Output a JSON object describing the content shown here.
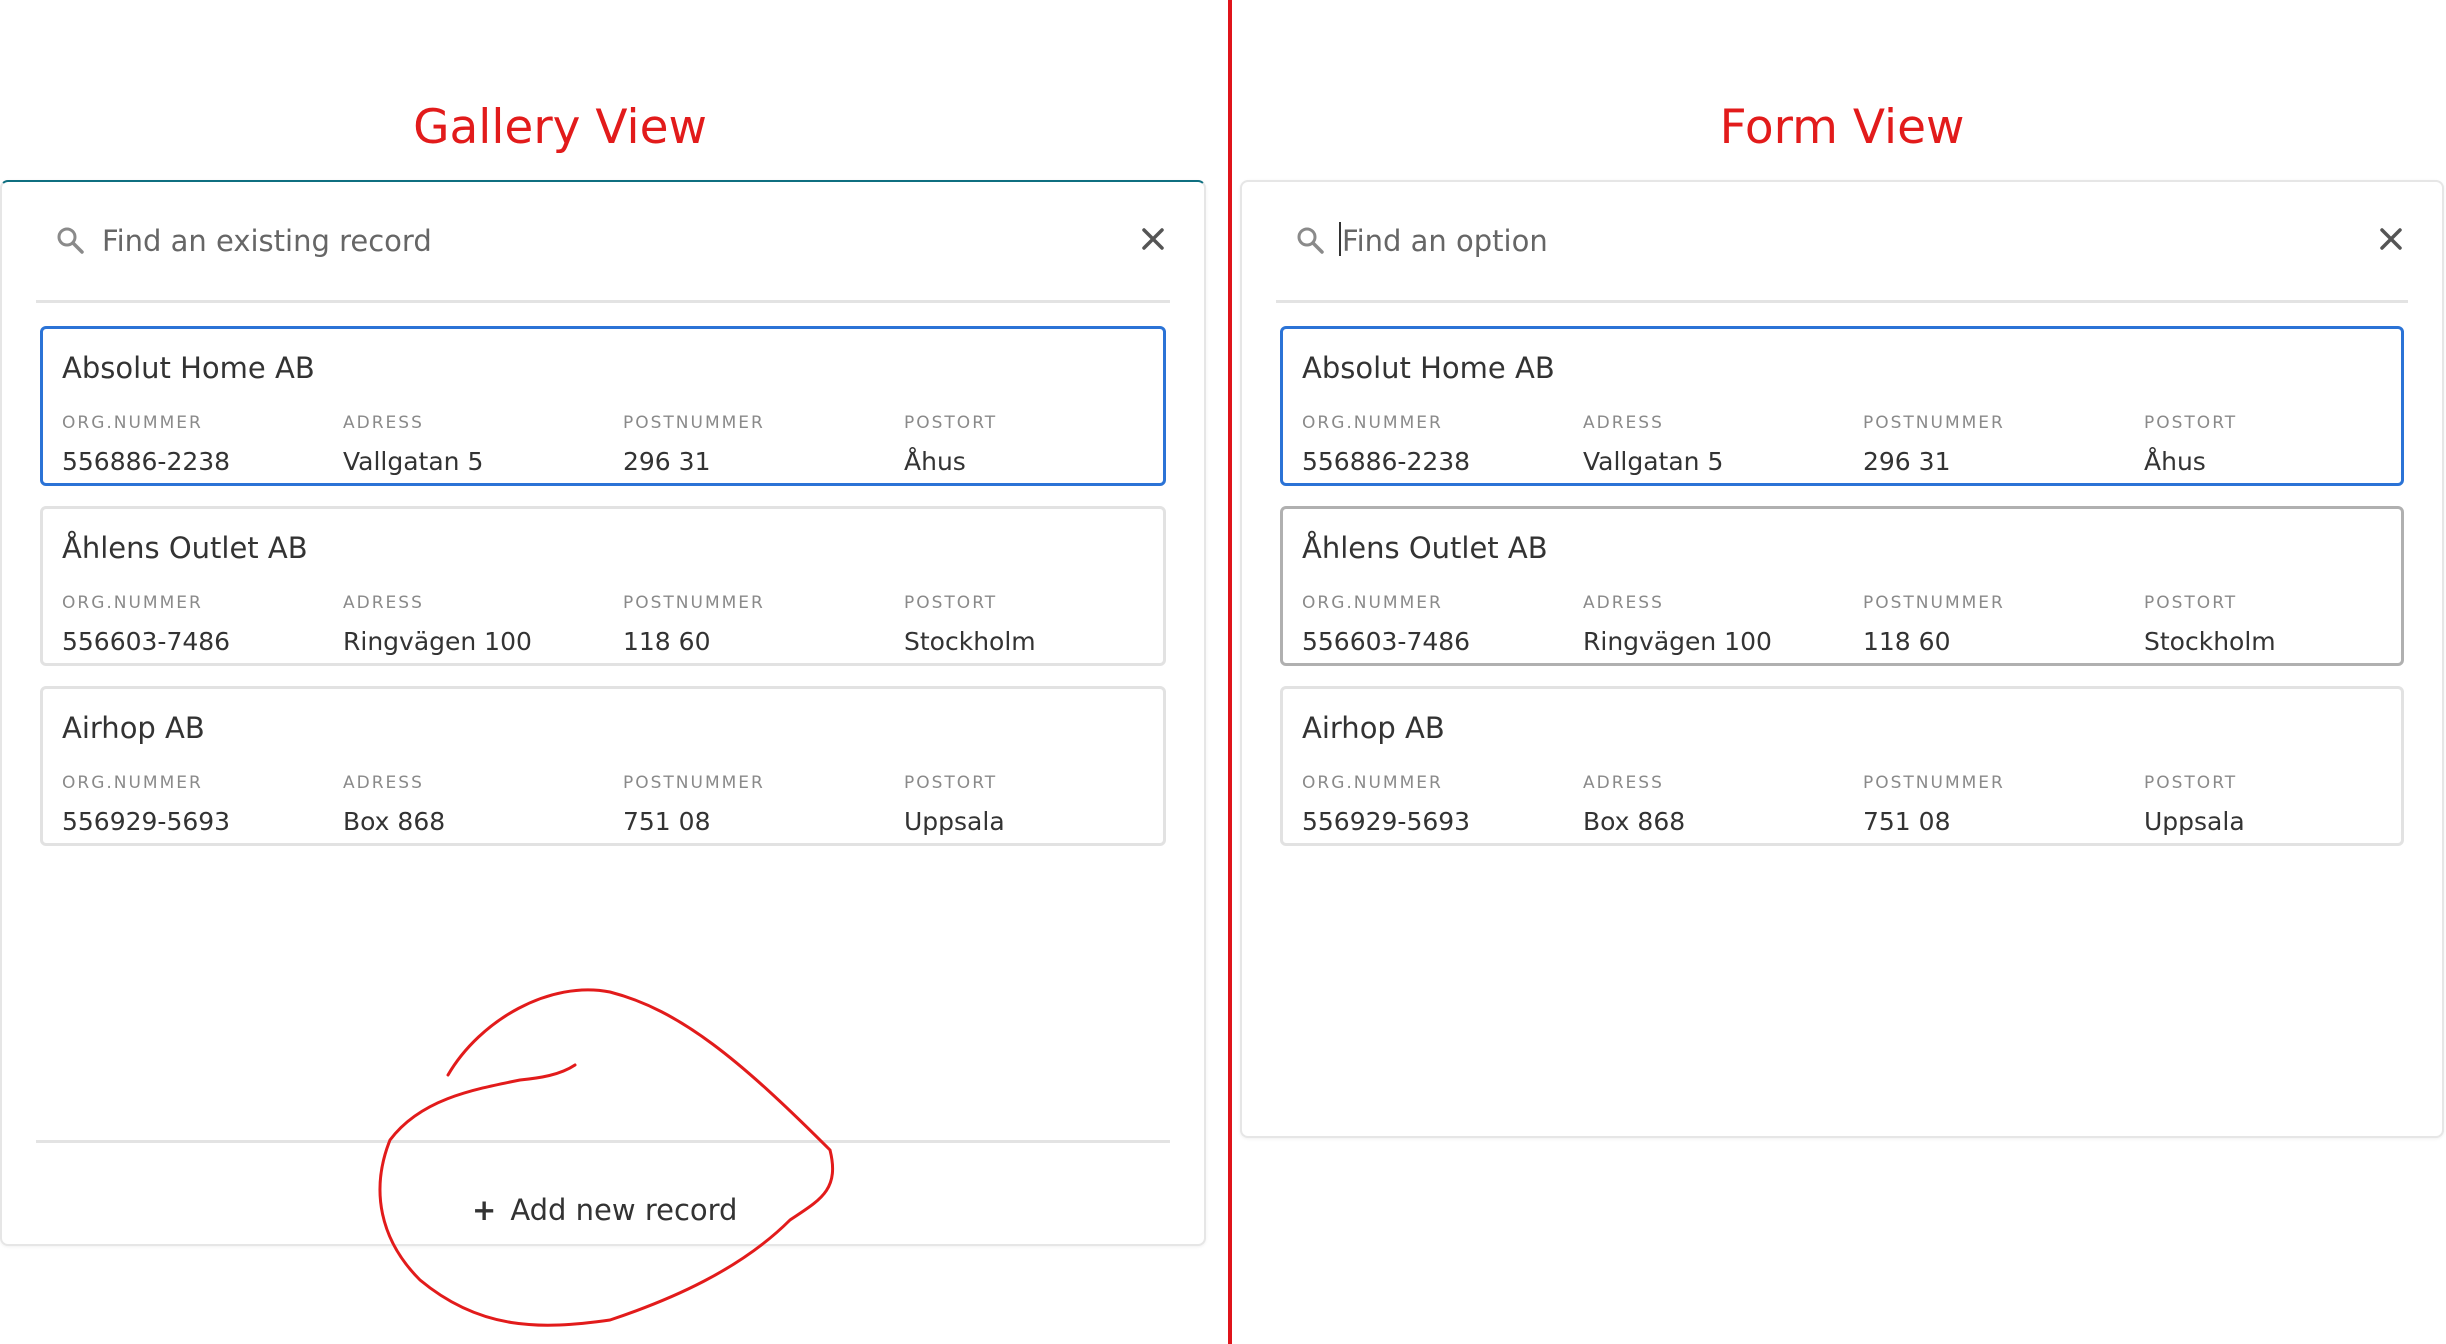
{
  "gallery": {
    "title": "Gallery View",
    "search": {
      "placeholder": "Find an existing record"
    },
    "records": [
      {
        "name": "Absolut Home AB",
        "fields": [
          {
            "label": "ORG.NUMMER",
            "value": "556886-2238"
          },
          {
            "label": "ADRESS",
            "value": "Vallgatan 5"
          },
          {
            "label": "POSTNUMMER",
            "value": "296 31"
          },
          {
            "label": "POSTORT",
            "value": "Åhus"
          }
        ]
      },
      {
        "name": "Åhlens Outlet AB",
        "fields": [
          {
            "label": "ORG.NUMMER",
            "value": "556603-7486"
          },
          {
            "label": "ADRESS",
            "value": "Ringvägen 100"
          },
          {
            "label": "POSTNUMMER",
            "value": "118 60"
          },
          {
            "label": "POSTORT",
            "value": "Stockholm"
          }
        ]
      },
      {
        "name": "Airhop AB",
        "fields": [
          {
            "label": "ORG.NUMMER",
            "value": "556929-5693"
          },
          {
            "label": "ADRESS",
            "value": "Box 868"
          },
          {
            "label": "POSTNUMMER",
            "value": "751 08"
          },
          {
            "label": "POSTORT",
            "value": "Uppsala"
          }
        ]
      }
    ],
    "add_button": {
      "icon": "+",
      "label": "Add new record"
    }
  },
  "form": {
    "title": "Form View",
    "search": {
      "placeholder": "Find an option"
    },
    "records": [
      {
        "name": "Absolut Home AB",
        "fields": [
          {
            "label": "ORG.NUMMER",
            "value": "556886-2238"
          },
          {
            "label": "ADRESS",
            "value": "Vallgatan 5"
          },
          {
            "label": "POSTNUMMER",
            "value": "296 31"
          },
          {
            "label": "POSTORT",
            "value": "Åhus"
          }
        ]
      },
      {
        "name": "Åhlens Outlet AB",
        "fields": [
          {
            "label": "ORG.NUMMER",
            "value": "556603-7486"
          },
          {
            "label": "ADRESS",
            "value": "Ringvägen 100"
          },
          {
            "label": "POSTNUMMER",
            "value": "118 60"
          },
          {
            "label": "POSTORT",
            "value": "Stockholm"
          }
        ]
      },
      {
        "name": "Airhop AB",
        "fields": [
          {
            "label": "ORG.NUMMER",
            "value": "556929-5693"
          },
          {
            "label": "ADRESS",
            "value": "Box 868"
          },
          {
            "label": "POSTNUMMER",
            "value": "751 08"
          },
          {
            "label": "POSTORT",
            "value": "Uppsala"
          }
        ]
      }
    ]
  },
  "colors": {
    "annotation": "#e21b1b",
    "selected_border": "#2b73d6",
    "hover_border": "#b0b0b0",
    "card_border": "#e2e2e2"
  },
  "icons": {
    "search": "search-icon",
    "close": "close-icon",
    "add": "plus-icon"
  }
}
